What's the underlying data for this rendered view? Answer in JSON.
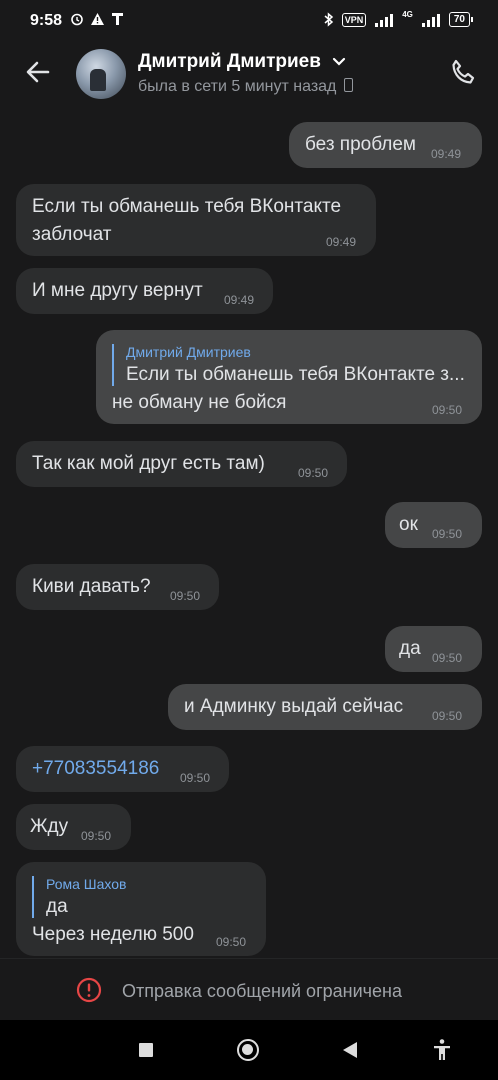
{
  "status_bar": {
    "time": "9:58",
    "vpn": "VPN",
    "network": "4G",
    "battery": "70"
  },
  "header": {
    "contact_name": "Дмитрий Дмитриев",
    "last_seen": "была в сети 5 минут назад"
  },
  "messages": [
    {
      "direction": "out",
      "text": "без проблем",
      "time": "09:49"
    },
    {
      "direction": "in",
      "lines": [
        "Если ты обманешь тебя ВКонтакте",
        "заблочат"
      ],
      "time": "09:49"
    },
    {
      "direction": "in",
      "text": "И мне другу вернут",
      "time": "09:49"
    },
    {
      "direction": "out",
      "reply_to": {
        "author": "Дмитрий Дмитриев",
        "text": "Если ты обманешь тебя ВКонтакте з..."
      },
      "text": "не обману не бойся",
      "time": "09:50"
    },
    {
      "direction": "in",
      "text": "Так как мой друг есть там)",
      "time": "09:50"
    },
    {
      "direction": "out",
      "text": "ок",
      "time": "09:50"
    },
    {
      "direction": "in",
      "text": "Киви давать?",
      "time": "09:50"
    },
    {
      "direction": "out",
      "text": "да",
      "time": "09:50"
    },
    {
      "direction": "out",
      "text": "и Админку выдай сейчас",
      "time": "09:50"
    },
    {
      "direction": "in",
      "text": "+77083554186",
      "time": "09:50",
      "is_link": true
    },
    {
      "direction": "in",
      "text": "Жду",
      "time": "09:50"
    },
    {
      "direction": "in",
      "reply_to": {
        "author": "Рома Шахов",
        "text": "да"
      },
      "text": "Через неделю 500",
      "time": "09:50"
    }
  ],
  "footer": {
    "restricted_text": "Отправка сообщений ограничена"
  },
  "icons": {
    "back": "arrow-left-icon",
    "call": "phone-icon",
    "warning": "exclamation-circle-icon"
  },
  "colors": {
    "background": "#19191a",
    "incoming_bubble": "#2c2d2e",
    "outgoing_bubble": "#454647",
    "accent": "#71aaeb",
    "warning": "#e64646"
  }
}
